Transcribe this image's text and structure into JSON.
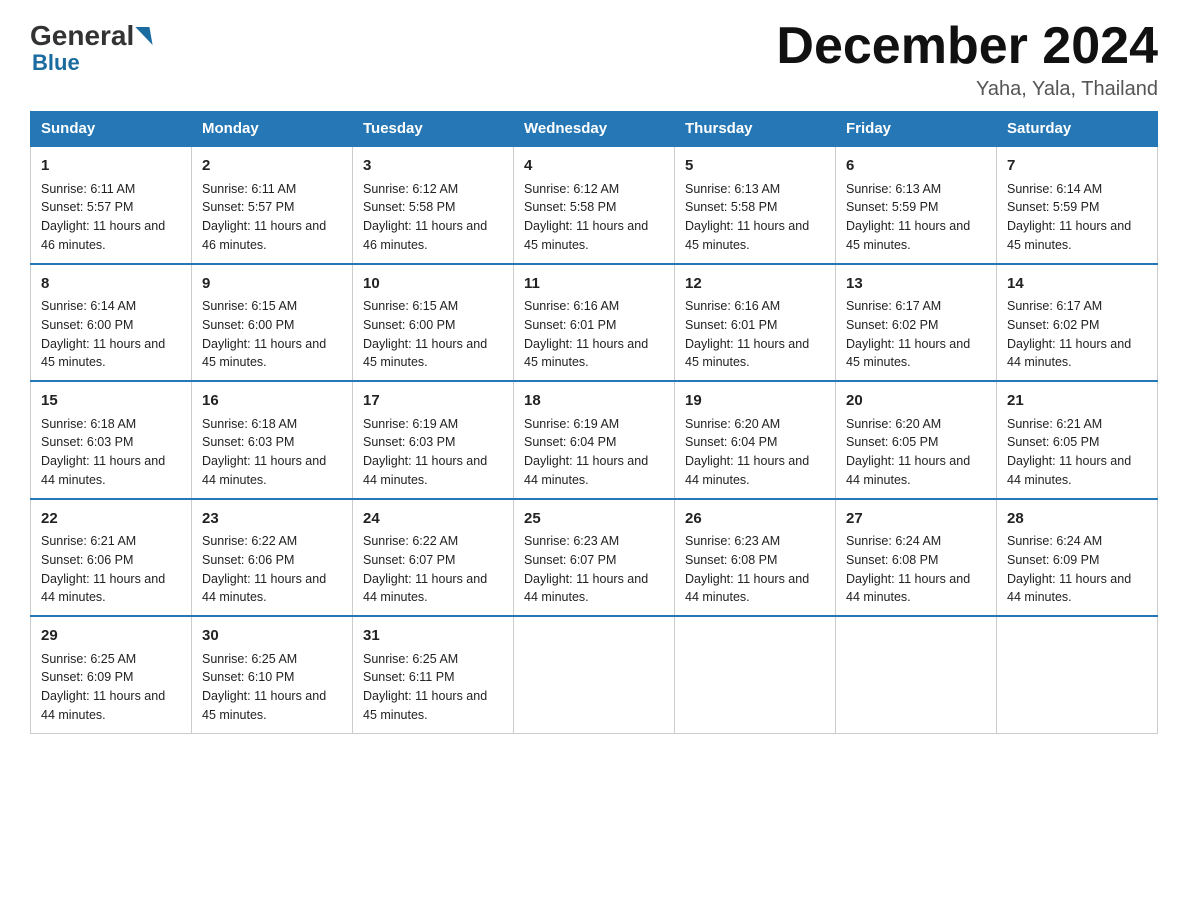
{
  "logo": {
    "general": "General",
    "blue": "Blue",
    "arrow": "▶"
  },
  "title": "December 2024",
  "location": "Yaha, Yala, Thailand",
  "days_of_week": [
    "Sunday",
    "Monday",
    "Tuesday",
    "Wednesday",
    "Thursday",
    "Friday",
    "Saturday"
  ],
  "weeks": [
    [
      {
        "day": "1",
        "sunrise": "6:11 AM",
        "sunset": "5:57 PM",
        "daylight": "11 hours and 46 minutes."
      },
      {
        "day": "2",
        "sunrise": "6:11 AM",
        "sunset": "5:57 PM",
        "daylight": "11 hours and 46 minutes."
      },
      {
        "day": "3",
        "sunrise": "6:12 AM",
        "sunset": "5:58 PM",
        "daylight": "11 hours and 46 minutes."
      },
      {
        "day": "4",
        "sunrise": "6:12 AM",
        "sunset": "5:58 PM",
        "daylight": "11 hours and 45 minutes."
      },
      {
        "day": "5",
        "sunrise": "6:13 AM",
        "sunset": "5:58 PM",
        "daylight": "11 hours and 45 minutes."
      },
      {
        "day": "6",
        "sunrise": "6:13 AM",
        "sunset": "5:59 PM",
        "daylight": "11 hours and 45 minutes."
      },
      {
        "day": "7",
        "sunrise": "6:14 AM",
        "sunset": "5:59 PM",
        "daylight": "11 hours and 45 minutes."
      }
    ],
    [
      {
        "day": "8",
        "sunrise": "6:14 AM",
        "sunset": "6:00 PM",
        "daylight": "11 hours and 45 minutes."
      },
      {
        "day": "9",
        "sunrise": "6:15 AM",
        "sunset": "6:00 PM",
        "daylight": "11 hours and 45 minutes."
      },
      {
        "day": "10",
        "sunrise": "6:15 AM",
        "sunset": "6:00 PM",
        "daylight": "11 hours and 45 minutes."
      },
      {
        "day": "11",
        "sunrise": "6:16 AM",
        "sunset": "6:01 PM",
        "daylight": "11 hours and 45 minutes."
      },
      {
        "day": "12",
        "sunrise": "6:16 AM",
        "sunset": "6:01 PM",
        "daylight": "11 hours and 45 minutes."
      },
      {
        "day": "13",
        "sunrise": "6:17 AM",
        "sunset": "6:02 PM",
        "daylight": "11 hours and 45 minutes."
      },
      {
        "day": "14",
        "sunrise": "6:17 AM",
        "sunset": "6:02 PM",
        "daylight": "11 hours and 44 minutes."
      }
    ],
    [
      {
        "day": "15",
        "sunrise": "6:18 AM",
        "sunset": "6:03 PM",
        "daylight": "11 hours and 44 minutes."
      },
      {
        "day": "16",
        "sunrise": "6:18 AM",
        "sunset": "6:03 PM",
        "daylight": "11 hours and 44 minutes."
      },
      {
        "day": "17",
        "sunrise": "6:19 AM",
        "sunset": "6:03 PM",
        "daylight": "11 hours and 44 minutes."
      },
      {
        "day": "18",
        "sunrise": "6:19 AM",
        "sunset": "6:04 PM",
        "daylight": "11 hours and 44 minutes."
      },
      {
        "day": "19",
        "sunrise": "6:20 AM",
        "sunset": "6:04 PM",
        "daylight": "11 hours and 44 minutes."
      },
      {
        "day": "20",
        "sunrise": "6:20 AM",
        "sunset": "6:05 PM",
        "daylight": "11 hours and 44 minutes."
      },
      {
        "day": "21",
        "sunrise": "6:21 AM",
        "sunset": "6:05 PM",
        "daylight": "11 hours and 44 minutes."
      }
    ],
    [
      {
        "day": "22",
        "sunrise": "6:21 AM",
        "sunset": "6:06 PM",
        "daylight": "11 hours and 44 minutes."
      },
      {
        "day": "23",
        "sunrise": "6:22 AM",
        "sunset": "6:06 PM",
        "daylight": "11 hours and 44 minutes."
      },
      {
        "day": "24",
        "sunrise": "6:22 AM",
        "sunset": "6:07 PM",
        "daylight": "11 hours and 44 minutes."
      },
      {
        "day": "25",
        "sunrise": "6:23 AM",
        "sunset": "6:07 PM",
        "daylight": "11 hours and 44 minutes."
      },
      {
        "day": "26",
        "sunrise": "6:23 AM",
        "sunset": "6:08 PM",
        "daylight": "11 hours and 44 minutes."
      },
      {
        "day": "27",
        "sunrise": "6:24 AM",
        "sunset": "6:08 PM",
        "daylight": "11 hours and 44 minutes."
      },
      {
        "day": "28",
        "sunrise": "6:24 AM",
        "sunset": "6:09 PM",
        "daylight": "11 hours and 44 minutes."
      }
    ],
    [
      {
        "day": "29",
        "sunrise": "6:25 AM",
        "sunset": "6:09 PM",
        "daylight": "11 hours and 44 minutes."
      },
      {
        "day": "30",
        "sunrise": "6:25 AM",
        "sunset": "6:10 PM",
        "daylight": "11 hours and 45 minutes."
      },
      {
        "day": "31",
        "sunrise": "6:25 AM",
        "sunset": "6:11 PM",
        "daylight": "11 hours and 45 minutes."
      },
      null,
      null,
      null,
      null
    ]
  ],
  "labels": {
    "sunrise": "Sunrise:",
    "sunset": "Sunset:",
    "daylight": "Daylight:"
  }
}
